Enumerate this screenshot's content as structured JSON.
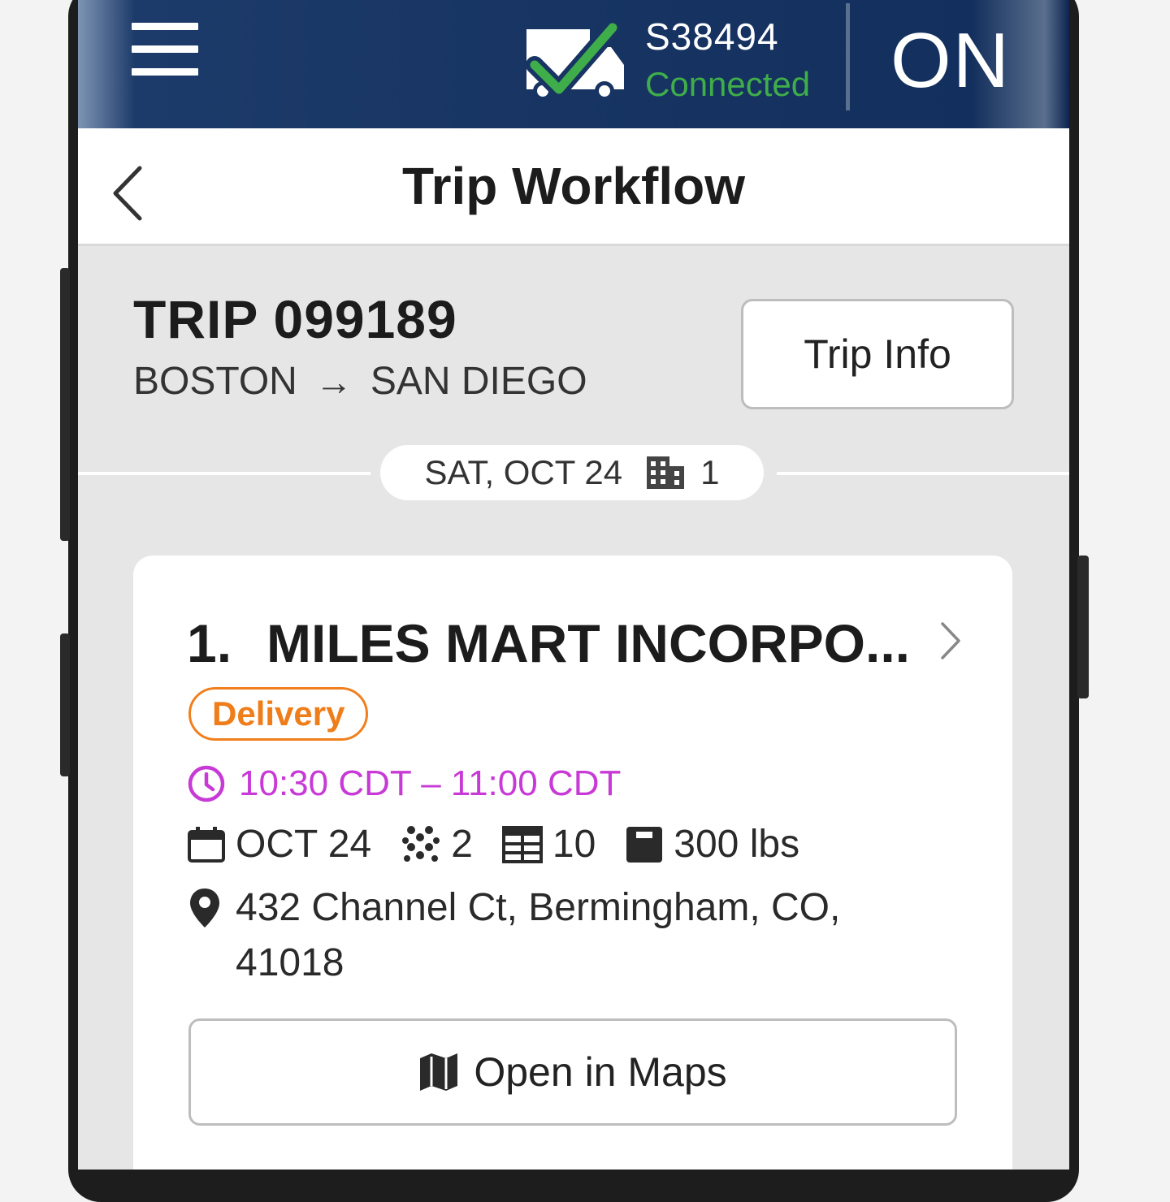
{
  "header": {
    "unit_id": "S38494",
    "connection_status": "Connected",
    "duty_status": "ON",
    "icons": {
      "menu": "hamburger-menu-icon",
      "truck": "truck-connected-icon"
    },
    "colors": {
      "bar": "#173462",
      "connected": "#3fae4a"
    }
  },
  "nav": {
    "title": "Trip Workflow",
    "back_icon": "chevron-left-icon"
  },
  "trip": {
    "title": "TRIP 099189",
    "origin": "BOSTON",
    "destination": "SAN DIEGO",
    "route_arrow": "→",
    "info_button": "Trip Info"
  },
  "day": {
    "date": "SAT, OCT 24",
    "stop_count": "1",
    "icon": "building-icon"
  },
  "stop": {
    "number": "1.",
    "name": "MILES MART INCORPO...",
    "type": "Delivery",
    "time_window": "10:30 CDT – 11:00 CDT",
    "date": "OCT 24",
    "pieces": "2",
    "pallets": "10",
    "weight": "300 lbs",
    "address": "432 Channel Ct, Bermingham, CO, 41018",
    "maps_button": "Open in Maps",
    "colors": {
      "badge": "#ef7d1a",
      "time": "#c73ad6"
    }
  }
}
